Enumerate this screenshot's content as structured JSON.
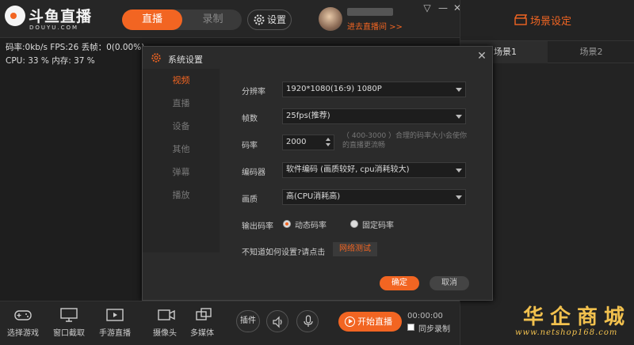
{
  "header": {
    "logo_title": "斗鱼直播",
    "logo_sub": "DOUYU.COM",
    "mode_live": "直播",
    "mode_record": "录制",
    "settings_label": "设置",
    "room_link": "进去直播间 >>"
  },
  "stats": {
    "line1": "码率:0kb/s   FPS:26   丢帧：0(0.00%)",
    "line2": "CPU: 33 %    内存: 37 %"
  },
  "scene": {
    "title": "场景设定",
    "tab1": "场景1",
    "tab2": "场景2"
  },
  "dialog": {
    "title": "系统设置",
    "nav": [
      "视频",
      "直播",
      "设备",
      "其他",
      "弹幕",
      "播放"
    ],
    "resolution_label": "分辨率",
    "resolution_value": "1920*1080(16:9) 1080P",
    "fps_label": "帧数",
    "fps_value": "25fps(推荐)",
    "bitrate_label": "码率",
    "bitrate_value": "2000",
    "bitrate_hint": "（ 400-3000 ）合理的码率大小会使你的直播更流畅",
    "encoder_label": "编码器",
    "encoder_value": "软件编码 (画质较好, cpu消耗较大)",
    "quality_label": "画质",
    "quality_value": "高(CPU消耗高)",
    "output_label": "输出码率",
    "dynamic_label": "动态码率",
    "fixed_label": "固定码率",
    "help_text": "不知道如何设置?请点击",
    "net_test": "网络测试",
    "ok": "确定",
    "cancel": "取消"
  },
  "toolbar": {
    "select_game": "选择游戏",
    "window_capture": "窗口截取",
    "mobile_live": "手游直播",
    "camera": "摄像头",
    "multimedia": "多媒体",
    "plugin": "插件",
    "start_live": "开始直播",
    "timer": "00:00:00",
    "sync_record": "同步录制"
  },
  "watermark": {
    "text": "华企商城",
    "url": "www.netshop168.com"
  },
  "colors": {
    "accent": "#f26522",
    "background": "#1e1e1e"
  }
}
